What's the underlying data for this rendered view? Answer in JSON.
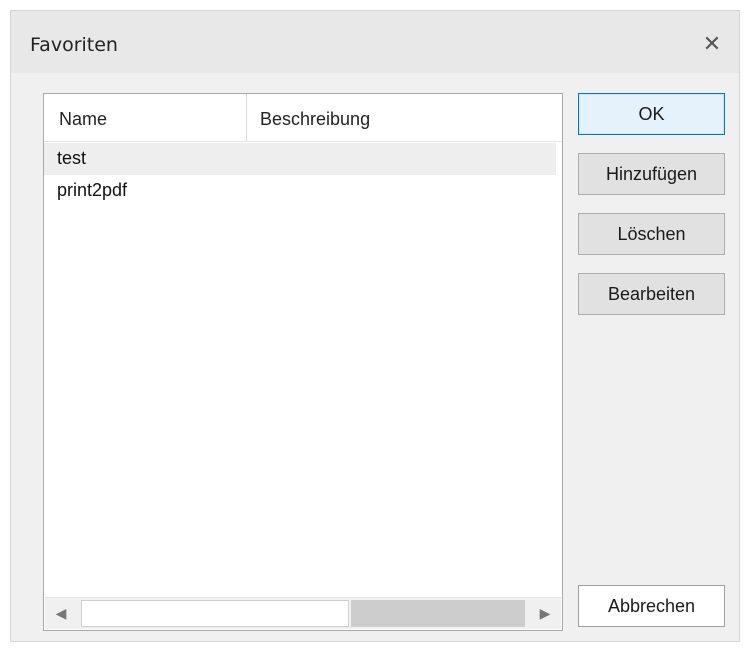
{
  "window": {
    "title": "Favoriten",
    "close_glyph": "✕"
  },
  "list": {
    "columns": [
      "Name",
      "Beschreibung"
    ],
    "rows": [
      {
        "name": "test",
        "description": "",
        "selected": true
      },
      {
        "name": "print2pdf",
        "description": "",
        "selected": false
      }
    ]
  },
  "scrollbar": {
    "left_glyph": "◀",
    "right_glyph": "▶"
  },
  "buttons": {
    "ok": "OK",
    "add": "Hinzufügen",
    "delete": "Löschen",
    "edit": "Bearbeiten",
    "cancel": "Abbrechen"
  },
  "colors": {
    "default_button_border": "#0078d7",
    "default_button_fill": "#e5f1fb",
    "dialog_background": "#f0f0f0"
  }
}
